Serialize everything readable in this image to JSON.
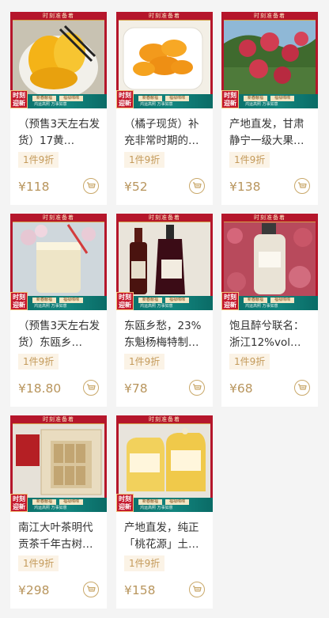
{
  "frame_banner": "时刻准备着",
  "seal_text": "时刻\n迎新",
  "strip_slot_texts": [
    "新春献福",
    "福禄绵绵"
  ],
  "strip_small_text": "鸿运高照  万事如意",
  "colors": {
    "accent_red": "#b5162b",
    "price_gold": "#b8955d",
    "discount_bg": "#fbf3e6",
    "strip_teal": "#12857e"
  },
  "products": [
    {
      "title": "（预售3天左右发货）17黄…",
      "discount": "1件9折",
      "price": "¥118"
    },
    {
      "title": "（橘子现货）补充非常时期的…",
      "discount": "1件9折",
      "price": "¥52"
    },
    {
      "title": "产地直发，甘肃静宁一级大果…",
      "discount": "1件9折",
      "price": "¥138"
    },
    {
      "title": "（预售3天左右发货）东瓯乡…",
      "discount": "1件9折",
      "price": "¥18.80"
    },
    {
      "title": "东瓯乡愁，23%东魁杨梅特制…",
      "discount": "1件9折",
      "price": "¥78"
    },
    {
      "title": "饱且醉兮联名：浙江12%vol…",
      "discount": "1件9折",
      "price": "¥68"
    },
    {
      "title": "南江大叶茶明代贡茶千年古树…",
      "discount": "1件9折",
      "price": "¥298"
    },
    {
      "title": "产地直发，纯正「桃花源」土…",
      "discount": "1件9折",
      "price": "¥158"
    }
  ]
}
